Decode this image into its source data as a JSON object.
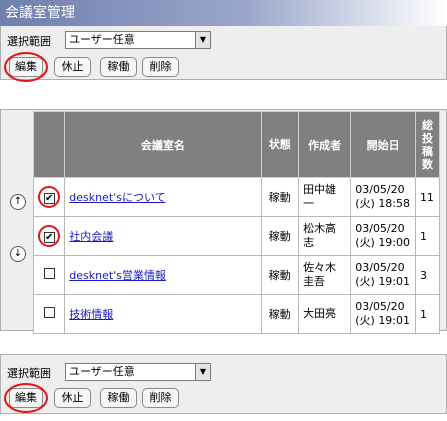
{
  "window": {
    "title": "会議室管理"
  },
  "controls": {
    "range_label": "選択範囲",
    "range_value": "ユーザー任意",
    "buttons": {
      "edit": "編集",
      "pause": "休止",
      "active": "稼働",
      "delete": "削除"
    }
  },
  "table": {
    "headers": {
      "name": "会議室名",
      "status": "状態",
      "creator": "作成者",
      "start": "開始日",
      "count": "総投稿数"
    },
    "rows": [
      {
        "checked": true,
        "name": "desknet'sについて",
        "status": "稼動",
        "creator": "田中雄一",
        "date": "03/05/20",
        "time": "(火) 18:58",
        "count": "11"
      },
      {
        "checked": true,
        "name": "社内会議",
        "status": "稼動",
        "creator": "松木高志",
        "date": "03/05/20",
        "time": "(火) 19:00",
        "count": "1"
      },
      {
        "checked": false,
        "name": "desknet's営業情報",
        "status": "稼動",
        "creator": "佐々木圭吾",
        "date": "03/05/20",
        "time": "(火) 19:01",
        "count": "3"
      },
      {
        "checked": false,
        "name": "技術情報",
        "status": "稼動",
        "creator": "大田亮",
        "date": "03/05/20",
        "time": "(火) 19:01",
        "count": "1"
      }
    ]
  },
  "icons": {
    "move_up": "up-arrow-icon",
    "move_down": "down-arrow-icon",
    "checkmark": "check-icon"
  },
  "colors": {
    "highlight_ring": "#e8121a",
    "header_bg": "#808080",
    "link": "#1a1ac8"
  }
}
